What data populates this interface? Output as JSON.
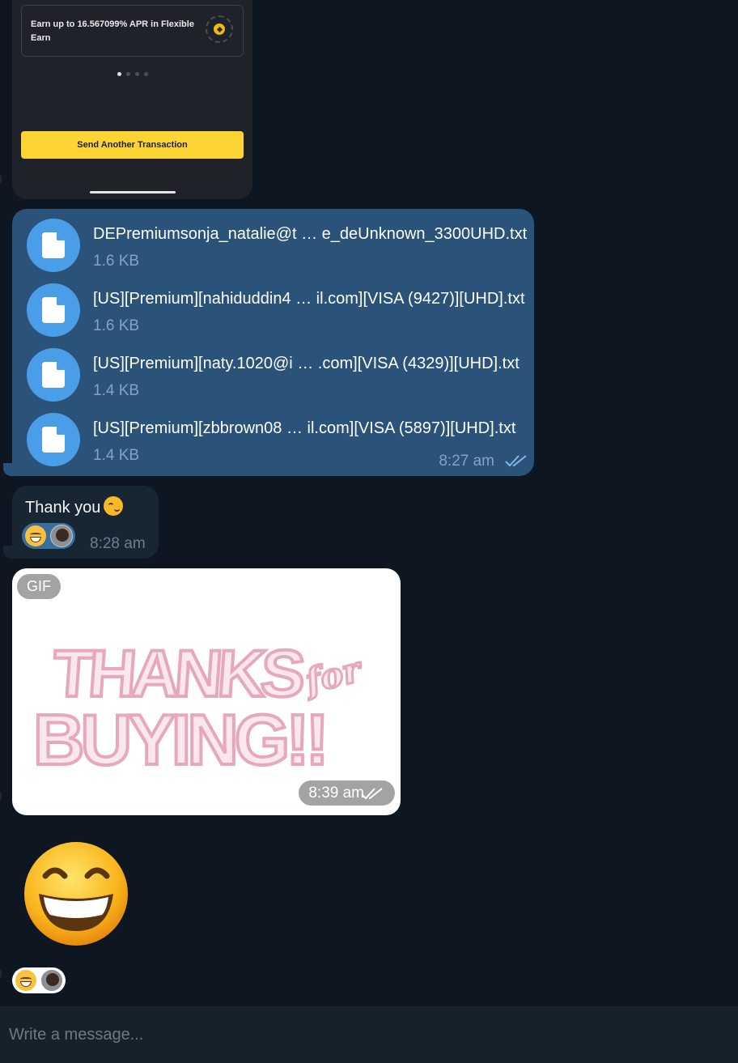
{
  "screenshot": {
    "promo_text": "Earn up to 16.567099% APR in Flexible Earn",
    "button_label": "Send Another Transaction"
  },
  "files_message": {
    "files": [
      {
        "name": "DEPremiumsonja_natalie@t … e_deUnknown_3300UHD.txt",
        "size": "1.6 KB"
      },
      {
        "name": "[US][Premium][nahiduddin4 … il.com][VISA (9427)][UHD].txt",
        "size": "1.6 KB"
      },
      {
        "name": "[US][Premium][naty.1020@i  …  .com][VISA (4329)][UHD].txt",
        "size": "1.4 KB"
      },
      {
        "name": "[US][Premium][zbbrown08  …  il.com][VISA (5897)][UHD].txt",
        "size": "1.4 KB"
      }
    ],
    "time": "8:27 am"
  },
  "thanks_message": {
    "text": "Thank you",
    "time": "8:28 am"
  },
  "gif_message": {
    "badge": "GIF",
    "text_line1": "THANKS",
    "text_for": "for",
    "text_line2": "BUYING!!",
    "time": "8:39 am"
  },
  "composer": {
    "placeholder": "Write a message..."
  },
  "colors": {
    "background": "#0e1621",
    "outgoing_bubble": "#2b5278",
    "incoming_bubble": "#182533",
    "file_icon": "#4a9ee8",
    "button_yellow": "#fcd535"
  }
}
